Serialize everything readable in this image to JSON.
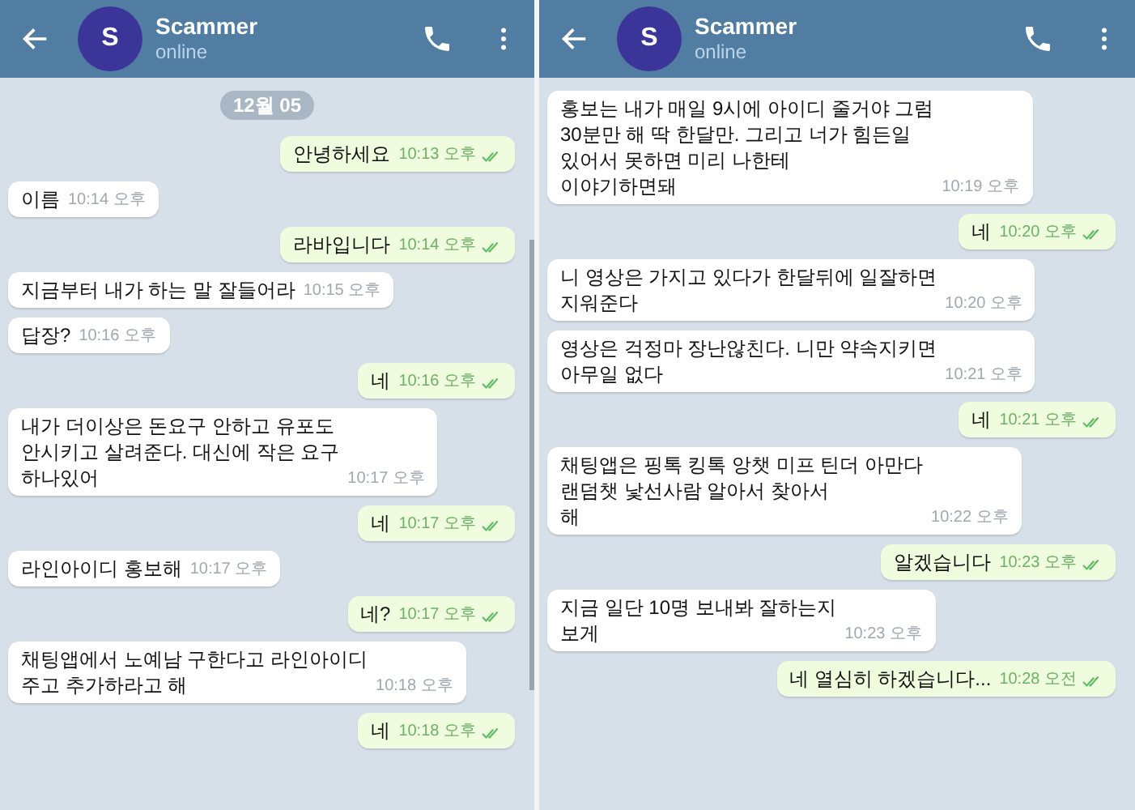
{
  "panels": [
    {
      "header": {
        "avatar_letter": "S",
        "name": "Scammer",
        "status": "online"
      },
      "date_badge": "12월 05",
      "scrollbar": true,
      "messages": [
        {
          "kind": "out",
          "text": "안녕하세요",
          "time": "10:13 오후",
          "read": true
        },
        {
          "kind": "in",
          "text": "이름",
          "time": "10:14 오후"
        },
        {
          "kind": "out",
          "text": "라바입니다",
          "time": "10:14 오후",
          "read": true
        },
        {
          "kind": "in",
          "text": "지금부터 내가 하는 말 잘들어라",
          "time": "10:15 오후"
        },
        {
          "kind": "in",
          "text": "답장?",
          "time": "10:16 오후"
        },
        {
          "kind": "out",
          "text": "네",
          "time": "10:16 오후",
          "read": true
        },
        {
          "kind": "in",
          "text": "내가 더이상은 돈요구 안하고 유포도\n안시키고 살려준다. 대신에 작은 요구\n하나있어",
          "time": "10:17 오후"
        },
        {
          "kind": "out",
          "text": "네",
          "time": "10:17 오후",
          "read": true
        },
        {
          "kind": "in",
          "text": "라인아이디 홍보해",
          "time": "10:17 오후"
        },
        {
          "kind": "out",
          "text": "네?",
          "time": "10:17 오후",
          "read": true
        },
        {
          "kind": "in",
          "text": "채팅앱에서 노예남 구한다고 라인아이디\n주고 추가하라고 해",
          "time": "10:18 오후"
        },
        {
          "kind": "out",
          "text": "네",
          "time": "10:18 오후",
          "read": true
        }
      ]
    },
    {
      "header": {
        "avatar_letter": "S",
        "name": "Scammer",
        "status": "online"
      },
      "messages": [
        {
          "kind": "in",
          "text": "홍보는 내가 매일 9시에 아이디 줄거야 그럼\n30분만 해 딱 한달만. 그리고 너가 힘든일\n있어서 못하면 미리 나한테\n이야기하면돼",
          "time": "10:19 오후"
        },
        {
          "kind": "out",
          "text": "네",
          "time": "10:20 오후",
          "read": true
        },
        {
          "kind": "in",
          "text": "니 영상은 가지고 있다가 한달뒤에 일잘하면\n지워준다",
          "time": "10:20 오후"
        },
        {
          "kind": "in",
          "text": "영상은 걱정마 장난않친다. 니만 약속지키면\n아무일 없다",
          "time": "10:21 오후"
        },
        {
          "kind": "out",
          "text": "네",
          "time": "10:21 오후",
          "read": true
        },
        {
          "kind": "in",
          "text": "채팅앱은 핑톡 킹톡 앙챗 미프 틴더 아만다\n랜덤챗 낯선사람 알아서 찾아서\n해",
          "time": "10:22 오후"
        },
        {
          "kind": "out",
          "text": "알겠습니다",
          "time": "10:23 오후",
          "read": true
        },
        {
          "kind": "in",
          "text": "지금 일단 10명 보내봐 잘하는지\n보게",
          "time": "10:23 오후"
        },
        {
          "kind": "out",
          "text": "네 열심히 하겠습니다...",
          "time": "10:28 오전",
          "read": true
        }
      ]
    }
  ]
}
